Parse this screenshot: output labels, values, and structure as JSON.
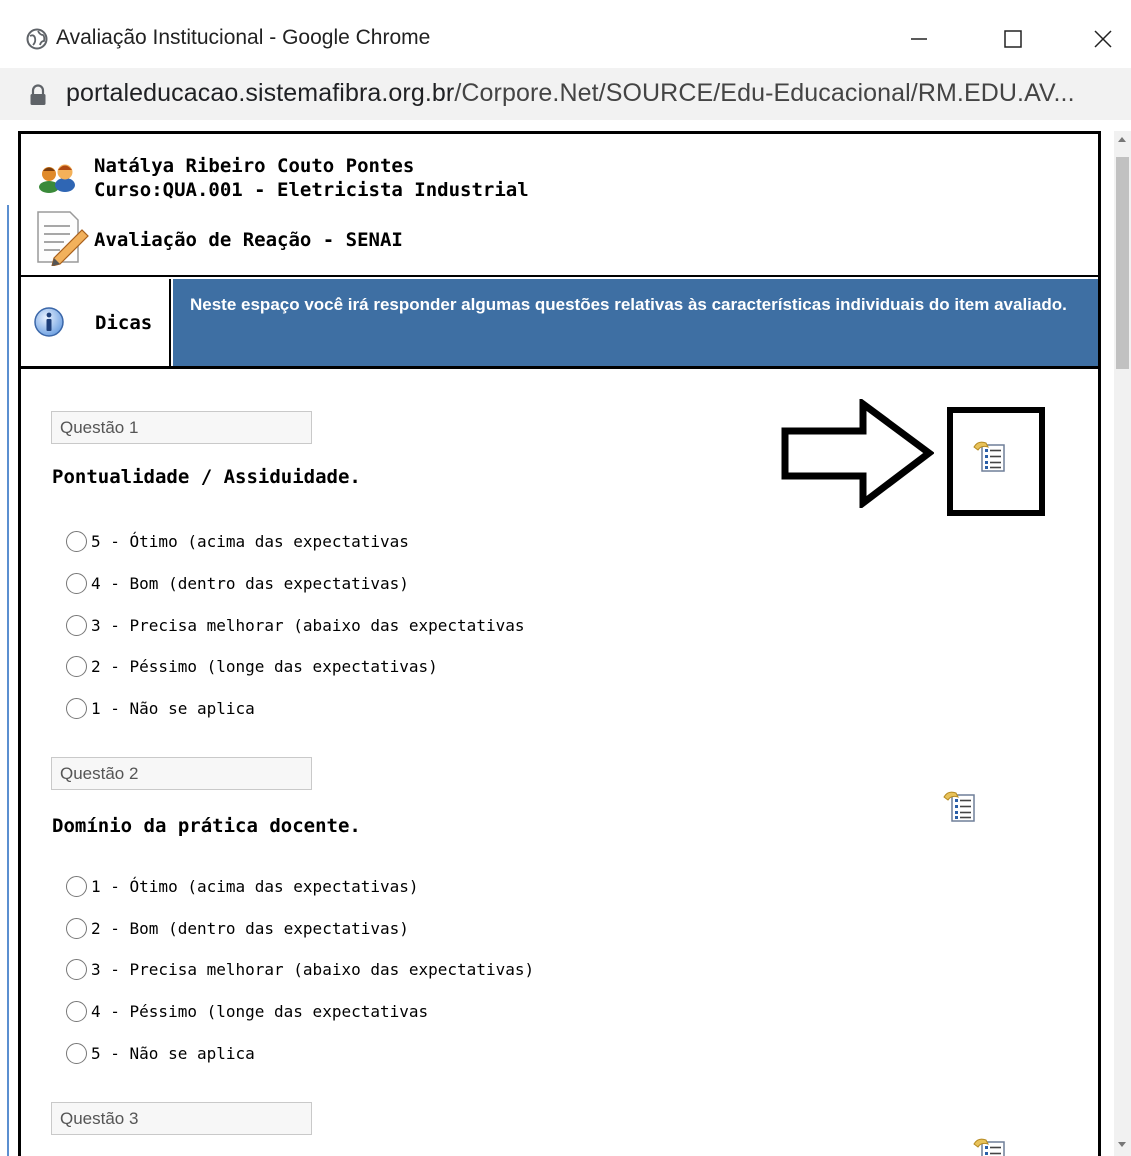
{
  "window": {
    "title": "Avaliação Institucional - Google Chrome",
    "url_host": "portaleducacao.sistemafibra.org.br",
    "url_path": "/Corpore.Net/SOURCE/Edu-Educacional/RM.EDU.AV..."
  },
  "header": {
    "user_name": "Natálya Ribeiro Couto Pontes",
    "course": "Curso:QUA.001 - Eletricista Industrial",
    "evaluation_title": "Avaliação de Reação - SENAI"
  },
  "tips": {
    "label": "Dicas",
    "text": "Neste espaço você irá responder algumas questões relativas às características individuais do item avaliado."
  },
  "questions": [
    {
      "label": "Questão 1",
      "title": "Pontualidade / Assiduidade.",
      "options": [
        "5 - Ótimo (acima das expectativas",
        "4 - Bom (dentro das expectativas)",
        "3 - Precisa melhorar (abaixo das expectativas",
        "2 - Péssimo (longe das expectativas)",
        "1 - Não se aplica"
      ]
    },
    {
      "label": "Questão 2",
      "title": "Domínio da prática docente.",
      "options": [
        "1 - Ótimo (acima das expectativas)",
        "2 - Bom (dentro das expectativas)",
        "3 - Precisa melhorar (abaixo das expectativas)",
        "4 - Péssimo (longe das expectativas",
        "5 - Não se aplica"
      ]
    },
    {
      "label": "Questão 3"
    }
  ],
  "colors": {
    "tips_bar": "#3e6fa3",
    "frame_border": "#000000"
  },
  "icons": {
    "window": [
      "globe-icon",
      "minimize-icon",
      "maximize-icon",
      "close-icon",
      "lock-icon"
    ],
    "page": [
      "users-icon",
      "edit-document-icon",
      "info-icon",
      "document-list-icon",
      "arrow-annotation"
    ]
  }
}
